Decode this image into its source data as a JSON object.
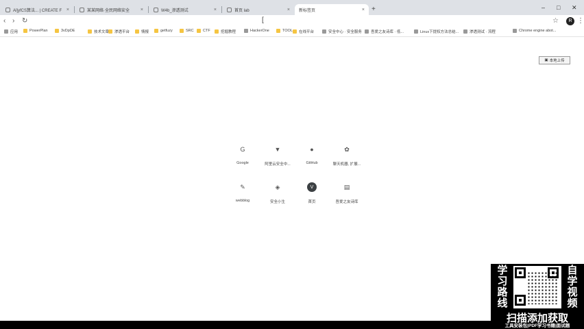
{
  "browser": {
    "tabs": [
      {
        "title": "Al]yfCS算法... | CREATE F",
        "active": false
      },
      {
        "title": "某某网络·全民网络安全",
        "active": false
      },
      {
        "title": "W4b_渗透测试",
        "active": false
      },
      {
        "title": "首页 lab",
        "active": false
      },
      {
        "title": "新标签页",
        "active": true
      }
    ],
    "new_tab_icon": "+",
    "window_controls": {
      "minimize": "–",
      "maximize": "□",
      "close": "✕"
    },
    "avatar_initial": "R"
  },
  "toolbar": {
    "back_icon": "‹",
    "forward_icon": "›",
    "reload_icon": "↻",
    "home_icon": "⌂",
    "omnibox_value": "[",
    "star_icon": "☆",
    "menu_icon": "⋮"
  },
  "bookmarks": [
    {
      "label": "应用",
      "type": "apps"
    },
    {
      "label": "PowerPlan",
      "type": "folder"
    },
    {
      "label": "3vDpDE",
      "type": "folder"
    },
    {
      "label": "技术文章",
      "type": "folder"
    },
    {
      "label": "渗透平台",
      "type": "folder"
    },
    {
      "label": "情报",
      "type": "folder"
    },
    {
      "label": "getfuzy",
      "type": "folder"
    },
    {
      "label": "SRC",
      "type": "folder"
    },
    {
      "label": "CTF",
      "type": "folder"
    },
    {
      "label": "挖掘教程",
      "type": "folder"
    },
    {
      "label": "HackerOne",
      "type": "site"
    },
    {
      "label": "TOOL",
      "type": "folder"
    },
    {
      "label": "在线平台",
      "type": "folder"
    },
    {
      "label": "安全中心 · 安全服务",
      "type": "site"
    },
    {
      "label": "吾爱之友诗库 · 低...",
      "type": "site"
    },
    {
      "label": "Linux下提权方法总结...",
      "type": "site"
    },
    {
      "label": "渗透测试 · 流程",
      "type": "site"
    },
    {
      "label": "Chrome engine abot...",
      "type": "site"
    }
  ],
  "upload_button": {
    "label": "本地上传"
  },
  "shortcuts": [
    {
      "label": "Google",
      "icon": "google-icon",
      "glyph": "G"
    },
    {
      "label": "阿里云安全中...",
      "icon": "shield-icon",
      "glyph": "▼"
    },
    {
      "label": "GitHub",
      "icon": "github-icon",
      "glyph": "●"
    },
    {
      "label": "聊天机器, 扩展...",
      "icon": "chat-icon",
      "glyph": "✿"
    },
    {
      "label": "webblog",
      "icon": "blog-icon",
      "glyph": "✎"
    },
    {
      "label": "安全小生",
      "icon": "badge-icon",
      "glyph": "◈"
    },
    {
      "label": "首页",
      "icon": "v-icon",
      "glyph": "V"
    },
    {
      "label": "吾爱之友诗库",
      "icon": "book-icon",
      "glyph": "▤"
    }
  ],
  "promo": {
    "left_text": [
      "学",
      "习",
      "路",
      "线"
    ],
    "right_text": [
      "自",
      "学",
      "视",
      "频"
    ],
    "headline": "扫描添加获取",
    "subline": "工具安装包|PDF学习书籍|面试题"
  }
}
